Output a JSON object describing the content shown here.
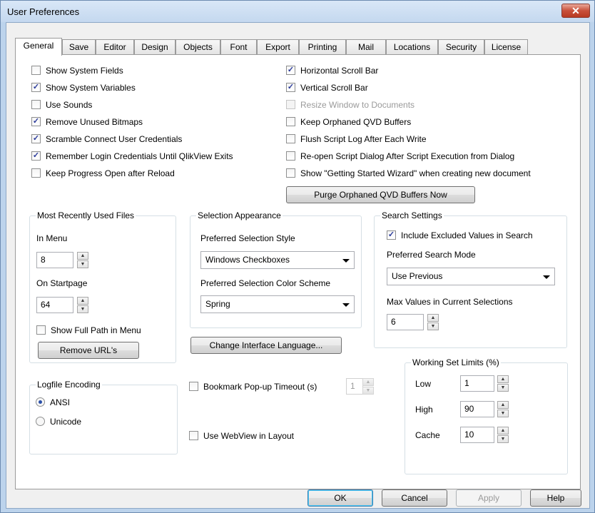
{
  "window": {
    "title": "User Preferences",
    "close_glyph": "✕"
  },
  "tabs": [
    {
      "label": "General",
      "active": true
    },
    {
      "label": "Save"
    },
    {
      "label": "Editor"
    },
    {
      "label": "Design"
    },
    {
      "label": "Objects"
    },
    {
      "label": "Font"
    },
    {
      "label": "Export"
    },
    {
      "label": "Printing"
    },
    {
      "label": "Mail"
    },
    {
      "label": "Locations"
    },
    {
      "label": "Security"
    },
    {
      "label": "License"
    }
  ],
  "left_options": [
    {
      "label": "Show System Fields",
      "checked": false
    },
    {
      "label": "Show System Variables",
      "checked": true
    },
    {
      "label": "Use Sounds",
      "checked": false
    },
    {
      "label": "Remove Unused Bitmaps",
      "checked": true
    },
    {
      "label": "Scramble Connect User Credentials",
      "checked": true
    },
    {
      "label": "Remember Login Credentials Until QlikView Exits",
      "checked": true
    },
    {
      "label": "Keep Progress Open after Reload",
      "checked": false
    }
  ],
  "right_options": [
    {
      "label": "Horizontal Scroll Bar",
      "checked": true
    },
    {
      "label": "Vertical Scroll Bar",
      "checked": true
    },
    {
      "label": "Resize Window to Documents",
      "checked": false,
      "disabled": true
    },
    {
      "label": "Keep Orphaned QVD Buffers",
      "checked": false
    },
    {
      "label": "Flush Script Log After Each Write",
      "checked": false
    },
    {
      "label": "Re-open Script Dialog After Script Execution from Dialog",
      "checked": false
    },
    {
      "label": "Show \"Getting Started Wizard\" when creating new document",
      "checked": false
    }
  ],
  "purge_button": "Purge Orphaned QVD Buffers Now",
  "mru": {
    "legend": "Most Recently Used Files",
    "in_menu_label": "In Menu",
    "in_menu_value": "8",
    "on_startpage_label": "On Startpage",
    "on_startpage_value": "64",
    "show_full_path_label": "Show Full Path in Menu",
    "show_full_path_checked": false,
    "remove_urls_button": "Remove URL's"
  },
  "selection": {
    "legend": "Selection Appearance",
    "style_label": "Preferred Selection Style",
    "style_value": "Windows Checkboxes",
    "scheme_label": "Preferred Selection Color Scheme",
    "scheme_value": "Spring"
  },
  "search": {
    "legend": "Search Settings",
    "include_excluded_label": "Include Excluded Values in Search",
    "include_excluded_checked": true,
    "mode_label": "Preferred Search Mode",
    "mode_value": "Use Previous",
    "max_values_label": "Max Values in Current Selections",
    "max_values_value": "6"
  },
  "change_language_button": "Change Interface Language...",
  "logfile": {
    "legend": "Logfile Encoding",
    "options": [
      {
        "label": "ANSI",
        "selected": true
      },
      {
        "label": "Unicode",
        "selected": false
      }
    ]
  },
  "bookmark": {
    "label": "Bookmark Pop-up Timeout (s)",
    "checked": false,
    "value": "1"
  },
  "webview": {
    "label": "Use WebView in Layout",
    "checked": false
  },
  "working_set": {
    "legend": "Working Set Limits (%)",
    "low_label": "Low",
    "low_value": "1",
    "high_label": "High",
    "high_value": "90",
    "cache_label": "Cache",
    "cache_value": "10"
  },
  "footer": {
    "ok": "OK",
    "cancel": "Cancel",
    "apply": "Apply",
    "help": "Help"
  },
  "glyphs": {
    "check": "✓",
    "spin_up": "▲",
    "spin_down": "▼"
  }
}
